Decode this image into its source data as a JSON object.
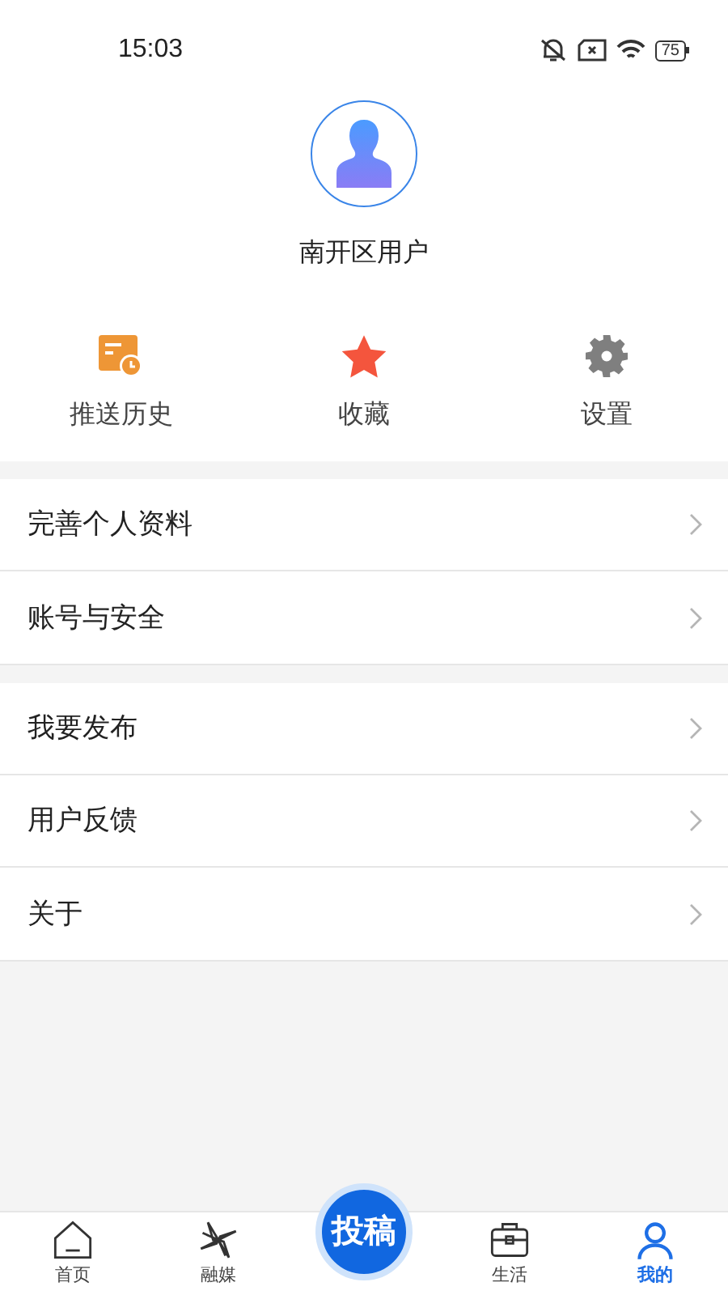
{
  "status_bar": {
    "time": "15:03",
    "battery": "75"
  },
  "profile": {
    "name": "南开区用户"
  },
  "quick_actions": [
    {
      "kind": "history",
      "label": "推送历史"
    },
    {
      "kind": "favorite",
      "label": "收藏"
    },
    {
      "kind": "settings",
      "label": "设置"
    }
  ],
  "menu_groups": [
    [
      {
        "label": "完善个人资料"
      },
      {
        "label": "账号与安全"
      }
    ],
    [
      {
        "label": "我要发布"
      },
      {
        "label": "用户反馈"
      },
      {
        "label": "关于"
      }
    ]
  ],
  "tab_bar": [
    {
      "kind": "home",
      "label": "首页",
      "selected": false
    },
    {
      "kind": "media",
      "label": "融媒",
      "selected": false
    },
    {
      "kind": "post",
      "label": "投稿",
      "selected": false
    },
    {
      "kind": "life",
      "label": "生活",
      "selected": false
    },
    {
      "kind": "me",
      "label": "我的",
      "selected": true
    }
  ]
}
